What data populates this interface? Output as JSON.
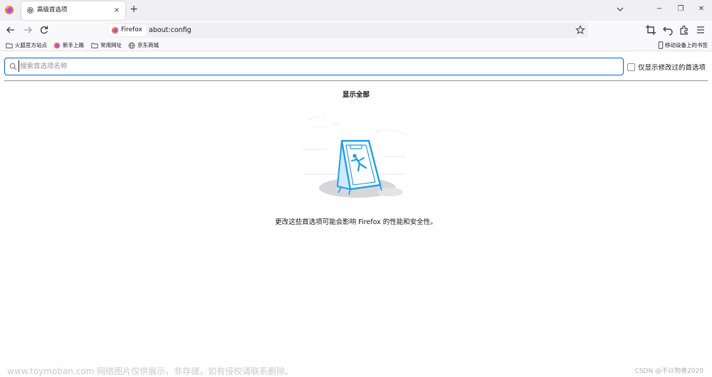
{
  "tab": {
    "title": "高级首选项",
    "close_glyph": "×"
  },
  "new_tab_glyph": "+",
  "window_controls": {
    "minimize": "−",
    "maximize": "❐",
    "close": "✕"
  },
  "urlbar": {
    "identity_label": "Firefox",
    "url": "about:config"
  },
  "bookmarks": {
    "items": [
      {
        "label": "火狐官方站点",
        "icon": "folder-icon"
      },
      {
        "label": "新手上路",
        "icon": "firefox-icon"
      },
      {
        "label": "常用网址",
        "icon": "folder-icon"
      },
      {
        "label": "京东商城",
        "icon": "globe-icon"
      }
    ],
    "mobile_label": "移动设备上的书签"
  },
  "search": {
    "placeholder": "搜索首选项名称",
    "value": ""
  },
  "modified_toggle": {
    "label": "仅显示修改过的首选项",
    "checked": false
  },
  "show_all_label": "显示全部",
  "warning_text": "更改这些首选项可能会影响 Firefox 的性能和安全性。",
  "watermark": "www.toymoban.com 网络图片仅供展示，非存储，如有侵权请联系删除。",
  "credit": "CSDN @不以物喜2020",
  "colors": {
    "accent": "#0061e0",
    "illustration_blue": "#1f9ee8"
  }
}
